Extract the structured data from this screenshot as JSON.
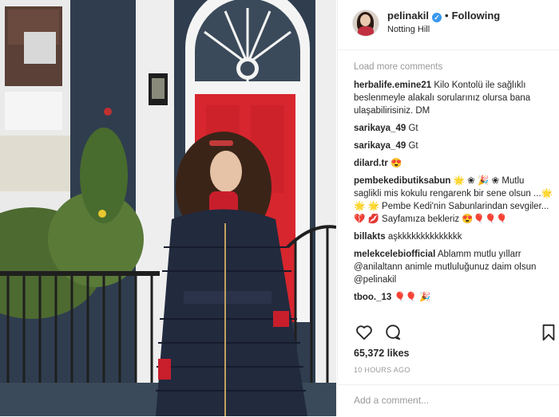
{
  "post": {
    "username": "pelinakil",
    "separator": "•",
    "follow_status": "Following",
    "location": "Notting Hill",
    "load_more": "Load more comments",
    "comments": [
      {
        "user": "herbalife.emine21",
        "text": "Kilo Kontolü ile sağlıklı beslenmeyle alakalı sorularınız olursa bana ulaşabilirisiniz. DM"
      },
      {
        "user": "sarikaya_49",
        "text": "Gt"
      },
      {
        "user": "sarikaya_49",
        "text": "Gt"
      },
      {
        "user": "dilard.tr",
        "text": "😍"
      },
      {
        "user": "pembekedibutiksabun",
        "text": "🌟 ❀ 🎉 ❀ Mutlu saglikli mis kokulu rengarenk bir sene olsun ...🌟🌟 🌟 Pembe Kedi'nin Sabunlarindan sevgiler...💔 💋 Sayfamıza bekleriz 😍🎈🎈🎈"
      },
      {
        "user": "billakts",
        "text": "aşkkkkkkkkkkkkkk"
      },
      {
        "user": "melekcelebiofficial",
        "text": "Ablamm mutlu yıllarr @anilaltann animle mutluluğunuz daim olsun @pelinakil"
      },
      {
        "user": "tboo._13",
        "text": "🎈🎈 🎉"
      }
    ],
    "likes": "65,372 likes",
    "time": "10 HOURS AGO",
    "add_comment_placeholder": "Add a comment..."
  },
  "icons": {
    "verified": "verified-badge-icon",
    "like": "heart-icon",
    "comment": "comment-bubble-icon",
    "save": "bookmark-icon"
  },
  "colors": {
    "verified_blue": "#3897f0",
    "muted_text": "#999999",
    "door_red": "#d7262e"
  }
}
